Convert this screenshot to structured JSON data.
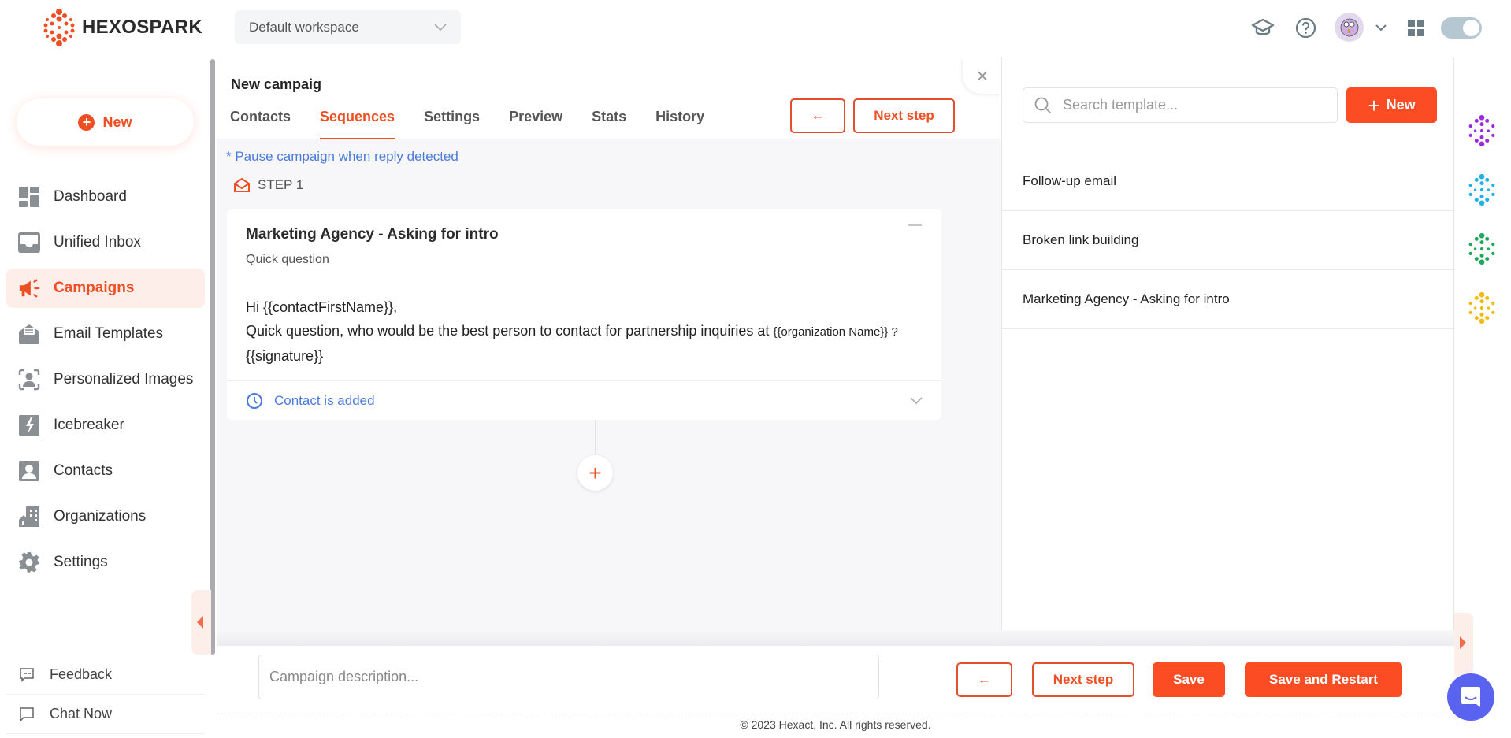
{
  "brand": {
    "name": "HEXOSPARK",
    "color": "#f04e23"
  },
  "header": {
    "workspace": "Default workspace",
    "icons": [
      "graduation-cap-icon",
      "help-icon",
      "avatar",
      "chevron-down-icon",
      "apps-grid-icon",
      "theme-toggle"
    ]
  },
  "sidebar": {
    "new_label": "New",
    "items": [
      {
        "label": "Dashboard",
        "icon": "dashboard-icon"
      },
      {
        "label": "Unified Inbox",
        "icon": "inbox-icon"
      },
      {
        "label": "Campaigns",
        "icon": "megaphone-icon",
        "active": true
      },
      {
        "label": "Email Templates",
        "icon": "email-template-icon"
      },
      {
        "label": "Personalized Images",
        "icon": "face-scan-icon"
      },
      {
        "label": "Icebreaker",
        "icon": "lightning-icon"
      },
      {
        "label": "Contacts",
        "icon": "contact-icon"
      },
      {
        "label": "Organizations",
        "icon": "building-icon"
      },
      {
        "label": "Settings",
        "icon": "gear-icon"
      }
    ],
    "footer": [
      {
        "label": "Feedback",
        "icon": "feedback-icon"
      },
      {
        "label": "Chat Now",
        "icon": "chat-icon"
      }
    ]
  },
  "campaign": {
    "title": "New campaig",
    "tabs": [
      "Contacts",
      "Sequences",
      "Settings",
      "Preview",
      "Stats",
      "History"
    ],
    "active_tab": "Sequences",
    "back_label": "←",
    "next_label": "Next step",
    "pause_note": "* Pause campaign when reply detected",
    "step_label": "STEP 1",
    "step": {
      "template_name": "Marketing Agency - Asking for intro",
      "subject": "Quick question",
      "body_line1": "Hi {{contactFirstName}},",
      "body_line2": "Quick question, who would be the best person to contact for partnership inquiries at ",
      "body_var": "{{organization Name}} ?",
      "body_line3": "{{signature}}",
      "trigger": "Contact is added"
    },
    "add_step_label": "+"
  },
  "templates": {
    "search_placeholder": "Search template...",
    "new_label": "New",
    "items": [
      "Follow-up email",
      "Broken link building",
      "Marketing Agency - Asking for intro"
    ]
  },
  "brand_variants": [
    "#9b2be0",
    "#1fb0e8",
    "#1fa85a",
    "#f2b90f"
  ],
  "footer": {
    "description_placeholder": "Campaign description...",
    "back_label": "←",
    "next_label": "Next step",
    "save_label": "Save",
    "save_restart_label": "Save and Restart",
    "copyright": "© 2023 Hexact, Inc. All rights reserved."
  }
}
